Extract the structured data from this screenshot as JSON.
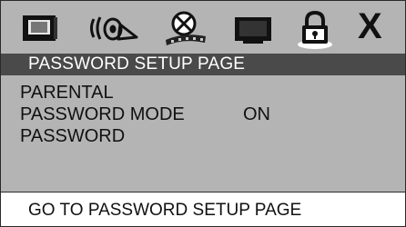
{
  "icon_bar": {
    "icons": [
      {
        "name": "general-setup-icon"
      },
      {
        "name": "audio-setup-icon"
      },
      {
        "name": "video-setup-icon"
      },
      {
        "name": "preference-setup-icon"
      },
      {
        "name": "password-lock-icon",
        "selected": true
      },
      {
        "name": "exit-icon"
      }
    ],
    "exit_glyph": "X"
  },
  "title": "PASSWORD SETUP PAGE",
  "menu": {
    "items": [
      {
        "label": "PARENTAL",
        "value": ""
      },
      {
        "label": "PASSWORD MODE",
        "value": "ON"
      },
      {
        "label": "PASSWORD",
        "value": ""
      }
    ]
  },
  "status": "GO TO PASSWORD SETUP PAGE",
  "colors": {
    "panel": "#b4b4b4",
    "title_bar": "#4a4a4a",
    "title_text": "#ffffff",
    "status_bar": "#ffffff",
    "selected_highlight": "#ffffff"
  }
}
